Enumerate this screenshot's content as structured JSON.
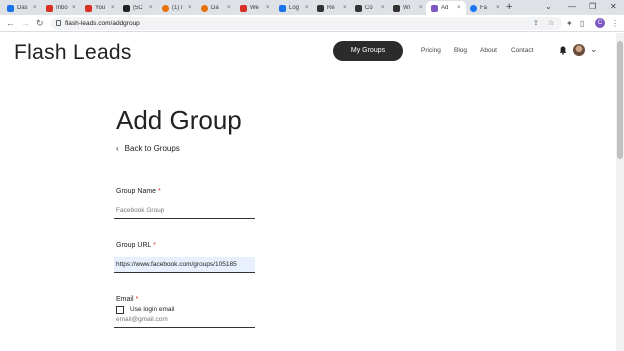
{
  "browser": {
    "tabs": [
      {
        "label": "Das",
        "color": "#1a73e8"
      },
      {
        "label": "Inbo",
        "color": "#d93025"
      },
      {
        "label": "You",
        "color": "#d93025"
      },
      {
        "label": "(5C",
        "color": "#222222"
      },
      {
        "label": "(1) I",
        "color": "#e8710a"
      },
      {
        "label": "Da",
        "color": "#e8710a"
      },
      {
        "label": "We",
        "color": "#d93025"
      },
      {
        "label": "Log",
        "color": "#1a73e8"
      },
      {
        "label": "Re",
        "color": "#333333"
      },
      {
        "label": "Co",
        "color": "#333333"
      },
      {
        "label": "Wi",
        "color": "#333333"
      },
      {
        "label": "Ad",
        "color": "#7e57c2"
      },
      {
        "label": "Fa",
        "color": "#1877f2"
      }
    ],
    "new_tab": "+",
    "url": "flash-leads.com/addgroup",
    "profile_initial": "C"
  },
  "header": {
    "logo": "Flash Leads",
    "my_groups": "My Groups",
    "nav": [
      "Pricing",
      "Blog",
      "About",
      "Contact"
    ]
  },
  "form": {
    "title": "Add Group",
    "back_link": "Back to Groups",
    "group_name_label": "Group Name",
    "group_name_placeholder": "Facebook Group",
    "group_url_label": "Group URL",
    "group_url_value": "https://www.facebook.com/groups/105185",
    "email_label": "Email",
    "email_placeholder": "email@gmail.com",
    "required_mark": "*",
    "use_login_label": "Use login email",
    "use_login_checked": false
  }
}
